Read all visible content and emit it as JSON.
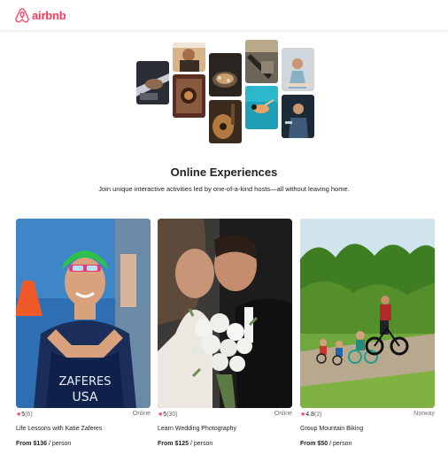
{
  "header": {
    "logo_text": "airbnb"
  },
  "hero": {
    "title": "Online Experiences",
    "subtitle": "Join unique interactive activities led by one-of-a-kind hosts—all without leaving home."
  },
  "cards": [
    {
      "rating": "5",
      "reviews": "(6)",
      "location": "Online",
      "name": "Life Lessons with Katie Zaferes",
      "price": "From $136",
      "unit": "/ person"
    },
    {
      "rating": "5",
      "reviews": "(30)",
      "location": "Online",
      "name": "Learn Wedding Photography",
      "price": "From $125",
      "unit": "/ person"
    },
    {
      "rating": "4.8",
      "reviews": "(2)",
      "location": "Norway",
      "name": "Group Mountain Biking",
      "price": "From $50",
      "unit": "/ person"
    }
  ],
  "athlete_jersey": {
    "line1": "ZAFERES",
    "line2": "USA"
  },
  "colors": {
    "brand": "#ff385c",
    "muted": "#717171"
  }
}
